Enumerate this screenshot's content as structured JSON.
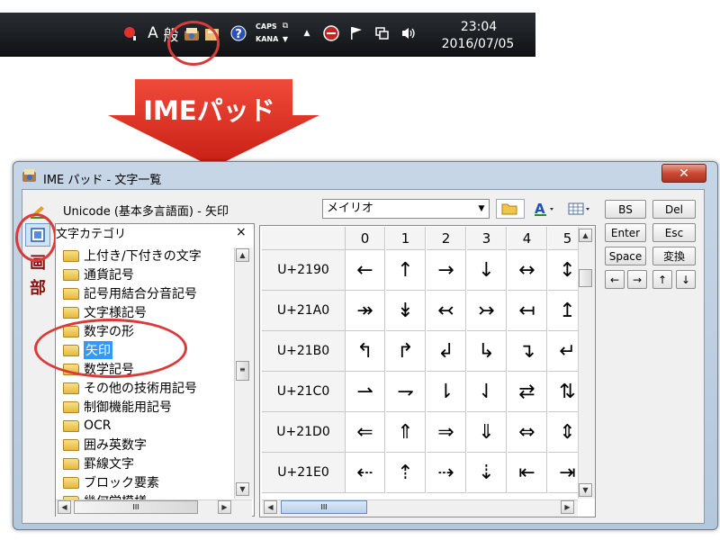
{
  "taskbar": {
    "ime_mode": "A",
    "ime_mode2": "般",
    "caps": "CAPS",
    "kana": "KANA",
    "show_hidden": "▲",
    "clock_time": "23:04",
    "clock_date": "2016/07/05"
  },
  "banner": {
    "label": "IMEパッド"
  },
  "window": {
    "title": "IME パッド - 文字一覧",
    "close_label": "✕"
  },
  "rail": {
    "item3": "画",
    "item4": "部"
  },
  "toolbar": {
    "unicode_label": "Unicode (基本多言語面) - 矢印",
    "font_value": "メイリオ",
    "font_dropdown": "▼"
  },
  "category": {
    "header": "文字カテゴリ",
    "close": "×",
    "items": [
      {
        "label": "上付き/下付きの文字"
      },
      {
        "label": "通貨記号"
      },
      {
        "label": "記号用結合分音記号"
      },
      {
        "label": "文字様記号"
      },
      {
        "label": "数字の形"
      },
      {
        "label": "矢印"
      },
      {
        "label": "数学記号"
      },
      {
        "label": "その他の技術用記号"
      },
      {
        "label": "制御機能用記号"
      },
      {
        "label": "OCR"
      },
      {
        "label": "囲み英数字"
      },
      {
        "label": "罫線文字"
      },
      {
        "label": "ブロック要素"
      },
      {
        "label": "幾何学模様"
      }
    ],
    "selected_index": 5,
    "hscroll_thumb": "III"
  },
  "grid": {
    "columns": [
      "0",
      "1",
      "2",
      "3",
      "4",
      "5"
    ],
    "rows": [
      {
        "code": "U+2190",
        "chars": [
          "←",
          "↑",
          "→",
          "↓",
          "↔",
          "↕"
        ]
      },
      {
        "code": "U+21A0",
        "chars": [
          "↠",
          "↡",
          "↢",
          "↣",
          "↤",
          "↥"
        ]
      },
      {
        "code": "U+21B0",
        "chars": [
          "↰",
          "↱",
          "↲",
          "↳",
          "↴",
          "↵"
        ]
      },
      {
        "code": "U+21C0",
        "chars": [
          "⇀",
          "⇁",
          "⇂",
          "⇃",
          "⇄",
          "⇅"
        ]
      },
      {
        "code": "U+21D0",
        "chars": [
          "⇐",
          "⇑",
          "⇒",
          "⇓",
          "⇔",
          "⇕"
        ]
      },
      {
        "code": "U+21E0",
        "chars": [
          "⇠",
          "⇡",
          "⇢",
          "⇣",
          "⇤",
          "⇥"
        ]
      }
    ],
    "hscroll_thumb": "III"
  },
  "keys": {
    "bs": "BS",
    "del": "Del",
    "enter": "Enter",
    "esc": "Esc",
    "space": "Space",
    "convert": "変換",
    "left": "←",
    "right": "→",
    "up": "↑",
    "down": "↓"
  },
  "colors": {
    "highlight_ring": "#d93b3b",
    "selection": "#3399ff",
    "arrow_red": "#d62a20"
  }
}
